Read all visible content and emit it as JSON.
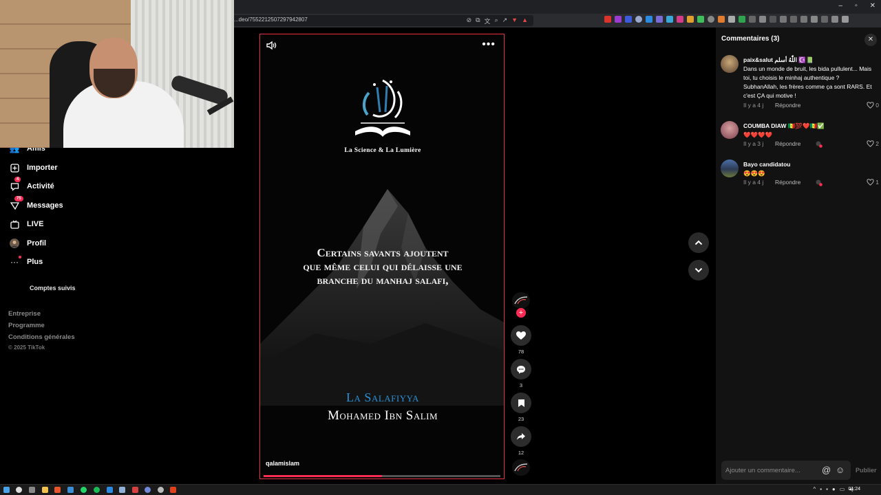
{
  "browser": {
    "url": "...deo/7552212507297942807",
    "window_controls": [
      "–",
      "▫",
      "✕"
    ]
  },
  "sidebar": {
    "items": [
      {
        "label": "Amis",
        "icon": "friends-icon"
      },
      {
        "label": "Importer",
        "icon": "upload-icon"
      },
      {
        "label": "Activité",
        "icon": "activity-icon",
        "badge": "4"
      },
      {
        "label": "Messages",
        "icon": "messages-icon",
        "badge": "75"
      },
      {
        "label": "LIVE",
        "icon": "live-icon"
      },
      {
        "label": "Profil",
        "icon": "profile-avatar-icon"
      },
      {
        "label": "Plus",
        "icon": "more-dots-icon"
      }
    ],
    "following_label": "Comptes suivis",
    "footer_links": [
      "Entreprise",
      "Programme",
      "Conditions générales"
    ],
    "copyright": "© 2025 TikTok"
  },
  "video": {
    "logo_subtitle": "La Science & La Lumière",
    "quote": "Certains savants ajoutent\nque même celui qui délaisse une\nbranche du manhaj salafi,",
    "title_line1": "La Salafiyya",
    "title_line2": "Mohamed Ibn Salim",
    "author": "qalamislam",
    "progress": 0.5,
    "colors": {
      "accent": "#fe2c55",
      "title_blue": "#2a8fd6",
      "border": "#e53345"
    }
  },
  "actions": {
    "likes": "78",
    "comments": "3",
    "saves": "23",
    "shares": "12"
  },
  "comments_panel": {
    "header": "Commentaires (3)",
    "input_placeholder": "Ajouter un commentaire...",
    "publish_label": "Publier",
    "items": [
      {
        "user": "paix&salut اللّٰهُ أسلم ☪️📗",
        "text": "Dans un monde de bruit, les bida pullulent... Mais toi, tu choisis le minhaj authentique ? SubhanAllah, les frères comme ça sont RARS. Et c'est ÇA qui motive !",
        "meta": "Il y a 4 j",
        "reply": "Répondre",
        "likes": "0"
      },
      {
        "user": "COUMBA DIAW 🇸🇳💯❤️🇸🇳✅",
        "text": "❤️❤️❤️❤️",
        "meta": "Il y a 3 j",
        "reply": "Répondre",
        "likes": "2"
      },
      {
        "user": "Bayo candidatou",
        "text": "😍😍😍",
        "meta": "Il y a 4 j",
        "reply": "Répondre",
        "likes": "1"
      }
    ]
  },
  "taskbar": {
    "clock": "01:24"
  }
}
